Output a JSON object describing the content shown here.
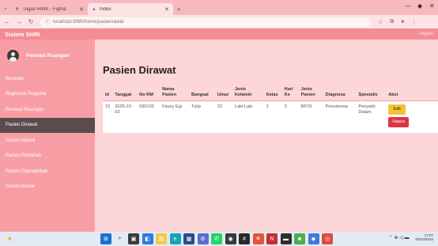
{
  "browser": {
    "tabs": [
      {
        "label": "Tugas RMIK - Figma",
        "active": false
      },
      {
        "label": "Index",
        "active": true
      }
    ],
    "url": "localhost:8080/home/pasienrawat"
  },
  "app": {
    "brand": "Sistem SHRI",
    "logout_label": "Logout"
  },
  "sidebar": {
    "user_name": "Perawat Ruangan",
    "items": [
      {
        "label": "Beranda",
        "active": false
      },
      {
        "label": "Registrasi Pegawai",
        "active": false
      },
      {
        "label": "Perawat Ruangan",
        "active": false
      },
      {
        "label": "Pasien Dirawat",
        "active": true
      },
      {
        "label": "Pasien Masuk",
        "active": false
      },
      {
        "label": "Pasien Pindahan",
        "active": false
      },
      {
        "label": "Pasien Dipindahkan",
        "active": false
      },
      {
        "label": "Pasien Keluar",
        "active": false
      }
    ]
  },
  "main": {
    "title": "Pasien Dirawat",
    "columns": [
      "Id",
      "Tanggal",
      "No RM",
      "Nama Pasien",
      "Bangsal",
      "Umur",
      "Jenis Kelamin",
      "Kelas",
      "Hari Ke",
      "Jenis Pasien",
      "Diagnosa",
      "Spesialis",
      "Aksi"
    ],
    "rows": [
      {
        "id": "15",
        "tanggal": "2025-10-03",
        "no_rm": "030105",
        "nama": "Fauzy Egi",
        "bangsal": "Tulip",
        "umur": "22",
        "jenis_kelamin": "Laki-Laki",
        "kelas": "1",
        "hari_ke": "3",
        "jenis_pasien": "BPJS",
        "diagnosa": "Pneumonia",
        "spesialis": "Penyakit Dalam",
        "edit_label": "Edit",
        "hapus_label": "Hapus"
      }
    ]
  },
  "colors": {
    "header": "#f48c94",
    "sidebar": "#f79ea5",
    "sidebar_active": "#5a4b4d",
    "content_bg": "#fcd6d8",
    "edit_button": "#f6c233",
    "hapus_button": "#dc3545"
  },
  "taskbar": {
    "icons": [
      "weather-icon",
      "windows-start-icon",
      "search-icon",
      "task-view-icon",
      "widgets-icon",
      "file-explorer-icon",
      "edge-icon",
      "store-icon",
      "settings-icon",
      "whatsapp-icon",
      "obs-icon",
      "obsidian-icon",
      "vscode-icon",
      "notion-icon",
      "terminal-icon",
      "app-icon",
      "photos-icon",
      "chrome-icon"
    ],
    "time": "17:07",
    "date": "03/10/2025"
  }
}
